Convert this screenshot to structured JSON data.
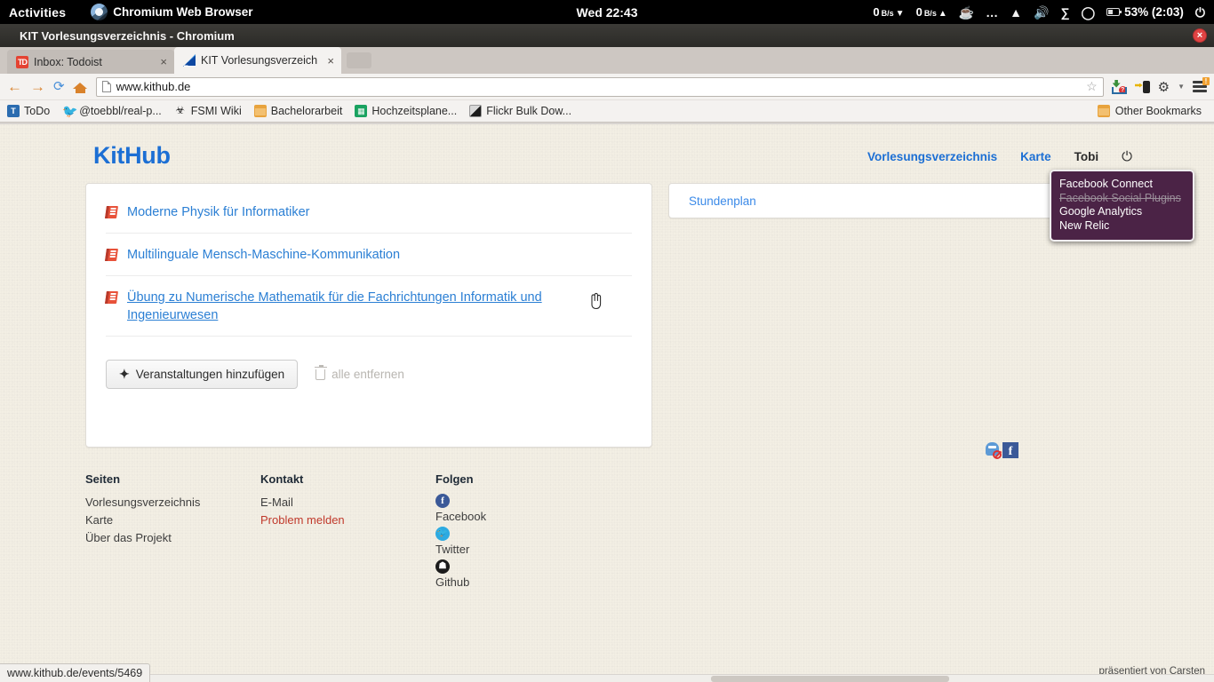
{
  "desktop": {
    "activities_label": "Activities",
    "app_name": "Chromium Web Browser",
    "clock": "Wed 22:43",
    "net_down": "0",
    "net_down_unit": "B/s",
    "net_up": "0",
    "net_up_unit": "B/s",
    "battery": "53% (2:03)"
  },
  "window": {
    "title": "KIT Vorlesungsverzeichnis - Chromium",
    "close_label": "×"
  },
  "tabs": [
    {
      "title": "Inbox: Todoist",
      "favicon": "todoist-icon",
      "close": "×",
      "active": false
    },
    {
      "title": "KIT Vorlesungsverzeichnis",
      "favicon": "kit-icon",
      "close": "×",
      "active": true
    }
  ],
  "toolbar": {
    "back": "←",
    "forward": "→",
    "reload": "⟳",
    "home": "home-icon",
    "url": "www.kithub.de",
    "star": "☆"
  },
  "bookmarks": [
    {
      "label": "ToDo",
      "icon": "todo-icon"
    },
    {
      "label": "@toebbl/real-p...",
      "icon": "twitter-icon"
    },
    {
      "label": "FSMI Wiki",
      "icon": "fsmi-icon"
    },
    {
      "label": "Bachelorarbeit",
      "icon": "folder-icon"
    },
    {
      "label": "Hochzeitsplane...",
      "icon": "sheets-icon"
    },
    {
      "label": "Flickr Bulk Dow...",
      "icon": "flickr-icon"
    }
  ],
  "bookmarks_other": "Other Bookmarks",
  "page": {
    "brand": "KitHub",
    "nav": [
      {
        "label": "Vorlesungsverzeichnis"
      },
      {
        "label": "Karte"
      }
    ],
    "user": "Tobi",
    "logout_icon": "power-icon",
    "courses": [
      {
        "title": "Moderne Physik für Informatiker",
        "hovered": false
      },
      {
        "title": "Multilinguale Mensch-Maschine-Kommunikation",
        "hovered": false
      },
      {
        "title": "Übung zu Numerische Mathematik für die Fachrichtungen Informatik und Ingenieurwesen",
        "hovered": true
      }
    ],
    "add_button": "Veranstaltungen hinzufügen",
    "add_button_plus": "✦",
    "remove_all": "alle entfernen",
    "schedule_link": "Stundenplan",
    "footer": {
      "col1_title": "Seiten",
      "col1_items": [
        "Vorlesungsverzeichnis",
        "Karte",
        "Über das Projekt"
      ],
      "col2_title": "Kontakt",
      "col2_items": [
        "E-Mail",
        "Problem melden"
      ],
      "col3_title": "Folgen",
      "col3_items": [
        {
          "label": "Facebook",
          "icon": "facebook-icon",
          "glyph": "f"
        },
        {
          "label": "Twitter",
          "icon": "twitter-icon",
          "glyph": "❦"
        },
        {
          "label": "Github",
          "icon": "github-icon",
          "glyph": "●"
        }
      ]
    },
    "credit_prefix": "präsentiert von ",
    "credit_link": "Carsten"
  },
  "ext_popup": {
    "items": [
      {
        "label": "Facebook Connect",
        "blocked": false
      },
      {
        "label": "Facebook Social Plugins",
        "blocked": true
      },
      {
        "label": "Google Analytics",
        "blocked": false
      },
      {
        "label": "New Relic",
        "blocked": false
      }
    ]
  },
  "status": {
    "link_target": "www.kithub.de/events/5469"
  },
  "colors": {
    "brand_blue": "#1c6fd4",
    "link_blue": "#2b7fd4",
    "page_bg": "#f3efe4",
    "popup_bg": "#4b2346",
    "alert_red": "#c0392b"
  }
}
